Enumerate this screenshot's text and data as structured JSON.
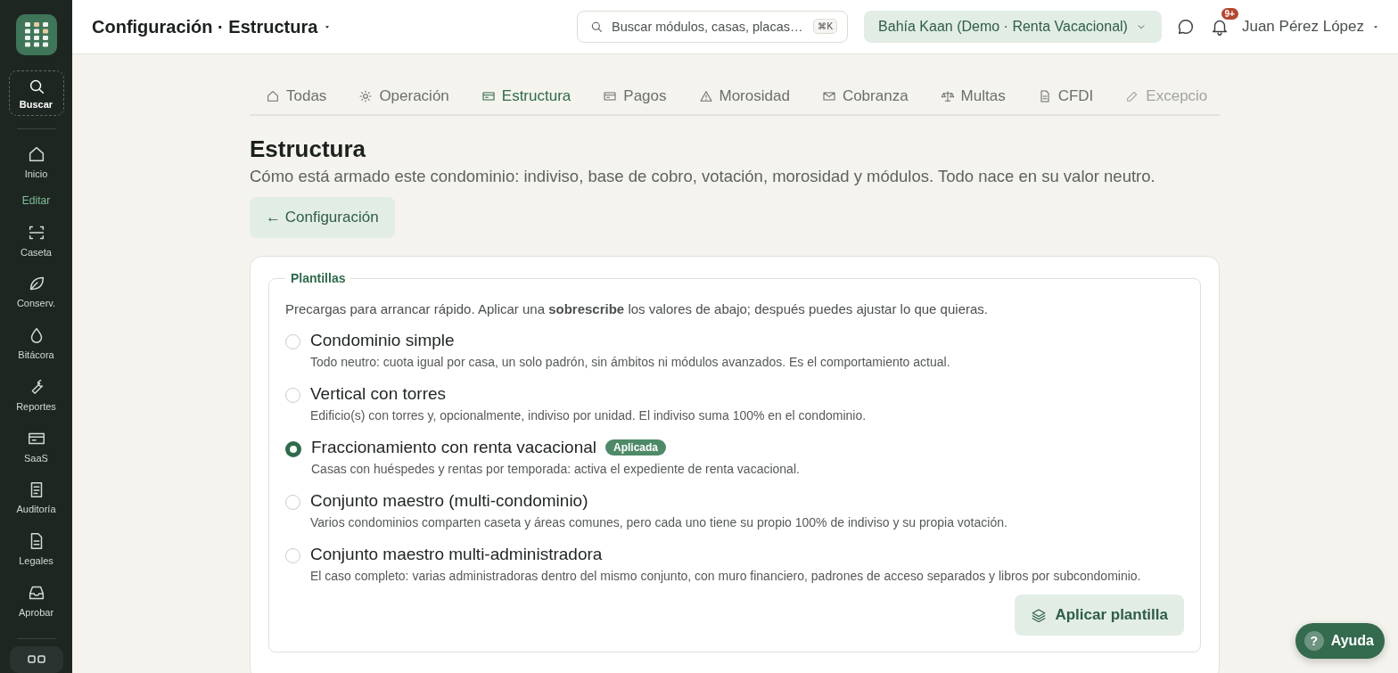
{
  "header": {
    "title": "Configuración · Estructura",
    "search": {
      "placeholder": "Buscar módulos, casas, placas…",
      "shortcut": "⌘K"
    },
    "organization": "Bahía Kaan (Demo · Renta Vacacional)",
    "notifications_badge": "9+",
    "user": "Juan Pérez López"
  },
  "sidebar": {
    "search_label": "Buscar",
    "items": [
      {
        "label": "Inicio",
        "kind": "item"
      },
      {
        "label": "Editar",
        "kind": "section"
      },
      {
        "label": "Caseta",
        "kind": "item"
      },
      {
        "label": "Conserv.",
        "kind": "item"
      },
      {
        "label": "Bitácora",
        "kind": "item"
      },
      {
        "label": "Reportes",
        "kind": "item"
      },
      {
        "label": "SaaS",
        "kind": "item"
      },
      {
        "label": "Auditoría",
        "kind": "item"
      },
      {
        "label": "Legales",
        "kind": "item"
      },
      {
        "label": "Aprobar",
        "kind": "item"
      }
    ],
    "apps_open": false
  },
  "tabs": [
    {
      "label": "Todas",
      "selected": false
    },
    {
      "label": "Operación",
      "selected": false
    },
    {
      "label": "Estructura",
      "selected": true
    },
    {
      "label": "Pagos",
      "selected": false
    },
    {
      "label": "Morosidad",
      "selected": false
    },
    {
      "label": "Cobranza",
      "selected": false
    },
    {
      "label": "Multas",
      "selected": false
    },
    {
      "label": "CFDI",
      "selected": false
    },
    {
      "label": "Excepcio",
      "selected": false
    }
  ],
  "page": {
    "title": "Estructura",
    "subtitle": "Cómo está armado este condominio: indiviso, base de cobro, votación, morosidad y módulos. Todo nace en su valor neutro.",
    "back_button": "← Configuración"
  },
  "templates": {
    "legend": "Plantillas",
    "description": "Precargas para arrancar rápido. Aplicar una **sobrescribe** los valores de abajo; después puedes ajustar lo que quieras.",
    "options": [
      {
        "name": "Condominio simple",
        "description": "Todo neutro: cuota igual por casa, un solo padrón, sin ámbitos ni módulos avanzados. Es el comportamiento actual.",
        "selected": false
      },
      {
        "name": "Vertical con torres",
        "description": "Edificio(s) con torres y, opcionalmente, indiviso por unidad. El indiviso suma 100% en el condominio.",
        "selected": false
      },
      {
        "name": "Fraccionamiento con renta vacacional",
        "description": "Casas con huéspedes y rentas por temporada: activa el expediente de renta vacacional.",
        "selected": true,
        "badge": "Aplicada"
      },
      {
        "name": "Conjunto maestro (multi-condominio)",
        "description": "Varios condominios comparten caseta y áreas comunes, pero cada uno tiene su propio 100% de indiviso y su propia votación.",
        "selected": false
      },
      {
        "name": "Conjunto maestro multi-administradora",
        "description": "El caso completo: varias administradoras dentro del mismo conjunto, con muro financiero, padrones de acceso separados y libros por subcondominio.",
        "selected": false
      }
    ],
    "apply_button": "Aplicar plantilla"
  },
  "help_button": {
    "icon": "?",
    "label": "Ayuda"
  }
}
